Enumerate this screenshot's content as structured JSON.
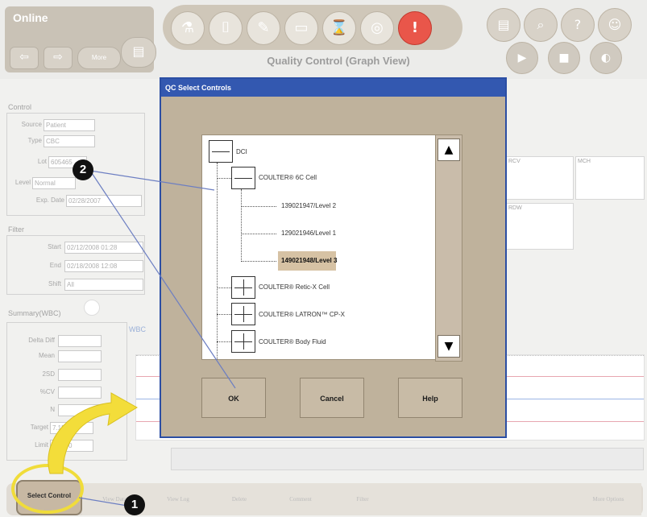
{
  "topbar": {
    "status": "Online",
    "more_label": "More",
    "page_title": "Quality Control (Graph View)",
    "alert_symbol": "!",
    "help_symbol": "?"
  },
  "control": {
    "section_label": "Control",
    "source_label": "Source",
    "source_value": "Patient",
    "type_label": "Type",
    "type_value": "CBC",
    "lot_label": "Lot",
    "lot_value": "605465",
    "level_label": "Level",
    "level_value": "Normal",
    "expdate_label": "Exp. Date",
    "expdate_value": "02/28/2007"
  },
  "filter": {
    "section_label": "Filter",
    "start_label": "Start",
    "start_value": "02/12/2008 01:28",
    "end_label": "End",
    "end_value": "02/18/2008 12:08",
    "shift_label": "Shift",
    "shift_value": "All"
  },
  "summary": {
    "section_label": "Summary(WBC)",
    "wbc_label": "WBC",
    "delta_label": "Delta Diff",
    "mean_label": "Mean",
    "sd_label": "2SD",
    "cv_label": "%CV",
    "n_label": "N",
    "target_label": "Target",
    "target_value": "7.150",
    "limit_label": "Limit",
    "limit_value": "21.000"
  },
  "right_panel": {
    "rcv_label": "RCV",
    "mch_label": "MCH",
    "rdw_label": "RDW"
  },
  "bottom_buttons": {
    "select_control": "Select Control",
    "view_data": "View Data",
    "view_log": "View Log",
    "delete": "Delete",
    "comment": "Comment",
    "filter": "Filter",
    "more_options": "More Options"
  },
  "dialog": {
    "title": "QC Select Controls",
    "tree": {
      "root": "DCI",
      "group1": "COULTER® 6C Cell",
      "item1": "139021947/Level 2",
      "item2": "129021946/Level 1",
      "item3": "149021948/Level 3",
      "group2": "COULTER® Retic-X Cell",
      "group3": "COULTER® LATRON™ CP-X",
      "group4": "COULTER® Body Fluid"
    },
    "ok_label": "OK",
    "cancel_label": "Cancel",
    "help_label": "Help",
    "scroll_up": "▲",
    "scroll_down": "▼"
  },
  "callouts": {
    "one": "1",
    "two": "2"
  },
  "colors": {
    "dialog_title_bg": "#3358b0",
    "dialog_bg": "#bfb29c",
    "selected_item_bg": "#d6c2a4",
    "highlight_ring": "#f0dc3a",
    "alert": "#e9564a"
  }
}
